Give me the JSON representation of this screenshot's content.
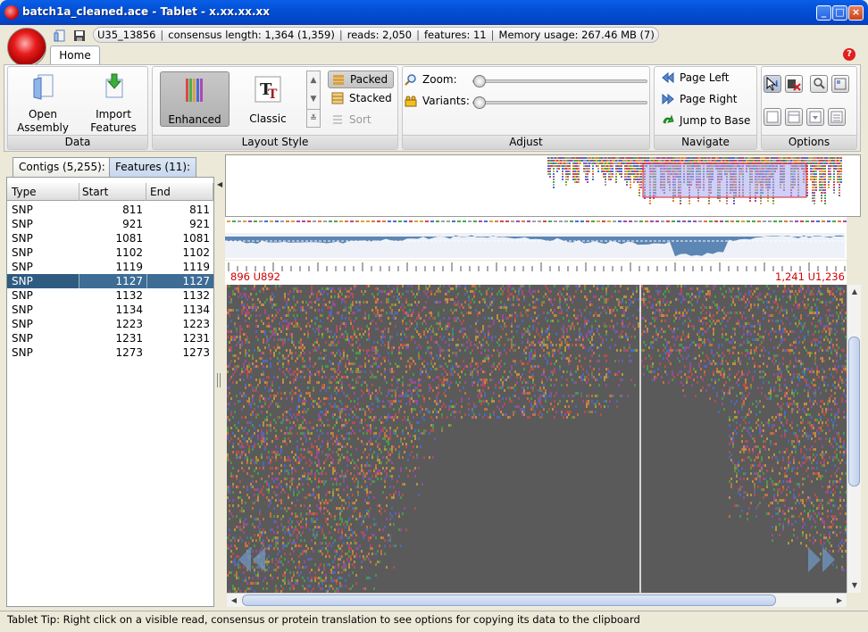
{
  "window": {
    "title": "batch1a_cleaned.ace - Tablet - x.xx.xx.xx",
    "minimize": "_",
    "maximize": "□",
    "close": "×"
  },
  "status": {
    "contig": "U35_13856",
    "consensus": "consensus length: 1,364 (1,359)",
    "reads": "reads: 2,050",
    "features": "features: 11",
    "memory": "Memory usage: 267.46 MB (7)"
  },
  "ribbon": {
    "tab": "Home",
    "help": "?",
    "data_group": {
      "title": "Data",
      "open_label": "Open\nAssembly",
      "open_l1": "Open",
      "open_l2": "Assembly",
      "import_l1": "Import",
      "import_l2": "Features"
    },
    "layout_group": {
      "title": "Layout Style",
      "enhanced": "Enhanced",
      "classic": "Classic",
      "packed": "Packed",
      "stacked": "Stacked",
      "sort": "Sort"
    },
    "adjust_group": {
      "title": "Adjust",
      "zoom": "Zoom:",
      "variants": "Variants:",
      "zoom_value": 0,
      "variants_value": 0
    },
    "navigate_group": {
      "title": "Navigate",
      "page_left": "Page Left",
      "page_right": "Page Right",
      "jump": "Jump to Base"
    },
    "options_group": {
      "title": "Options"
    }
  },
  "left_tabs": {
    "contigs": "Contigs (5,255):",
    "features": "Features (11):"
  },
  "features_table": {
    "headers": [
      "Type",
      "Start",
      "End"
    ],
    "rows": [
      [
        "SNP",
        "811",
        "811"
      ],
      [
        "SNP",
        "921",
        "921"
      ],
      [
        "SNP",
        "1081",
        "1081"
      ],
      [
        "SNP",
        "1102",
        "1102"
      ],
      [
        "SNP",
        "1119",
        "1119"
      ],
      [
        "SNP",
        "1127",
        "1127"
      ],
      [
        "SNP",
        "1132",
        "1132"
      ],
      [
        "SNP",
        "1134",
        "1134"
      ],
      [
        "SNP",
        "1223",
        "1223"
      ],
      [
        "SNP",
        "1231",
        "1231"
      ],
      [
        "SNP",
        "1273",
        "1273"
      ]
    ],
    "selected_index": 5
  },
  "view": {
    "ruler_left": "896 U892",
    "ruler_right": "1,241 U1,236"
  },
  "tip": "Tablet Tip: Right click on a visible read, consensus or protein translation to see options for copying its data to the clipboard",
  "colors": {
    "title_bar": "#0350d6",
    "selection": "#2f5b80",
    "ruler_label": "#d00000",
    "view_bg": "#5a5a5a"
  }
}
